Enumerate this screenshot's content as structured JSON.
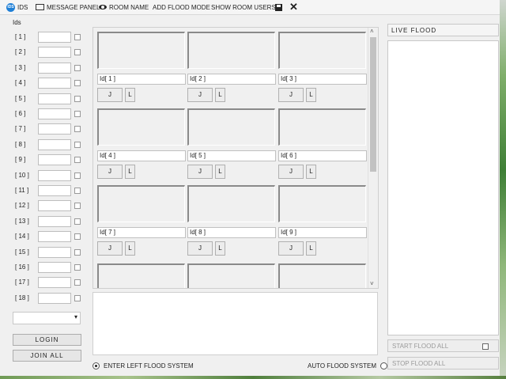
{
  "menu": {
    "ids": "IDS",
    "message_panel": "MESSAGE PANEL",
    "room_name": "ROOM NAME",
    "add_flood_mode": "ADD FLOOD MODE",
    "show_room_users": "SHOW ROOM USERS"
  },
  "left": {
    "title": "Ids",
    "rows": [
      "[ 1 ]",
      "[ 2 ]",
      "[ 3 ]",
      "[ 4 ]",
      "[ 5 ]",
      "[ 6 ]",
      "[ 7 ]",
      "[ 8 ]",
      "[ 9 ]",
      "[ 10 ]",
      "[ 11 ]",
      "[ 12 ]",
      "[ 13 ]",
      "[ 14 ]",
      "[ 15 ]",
      "[ 16 ]",
      "[ 17 ]",
      "[ 18 ]"
    ],
    "login": "LOGIN",
    "join_all": "JOIN ALL"
  },
  "grid": {
    "cells": [
      "Id[ 1 ]",
      "Id[ 2 ]",
      "Id[ 3 ]",
      "Id[ 4 ]",
      "Id[ 5 ]",
      "Id[ 6 ]",
      "Id[ 7 ]",
      "Id[ 8 ]",
      "Id[ 9 ]"
    ],
    "j_label": "J",
    "l_label": "L",
    "scroll_up": "˄",
    "scroll_down": "˅"
  },
  "bottom": {
    "enter_left": "ENTER LEFT FLOOD SYSTEM",
    "auto_flood": "AUTO FLOOD SYSTEM"
  },
  "right": {
    "live_flood": "LIVE FLOOD",
    "start_flood_all": "START FLOOD ALL",
    "stop_flood_all": "STOP FLOOD ALL"
  }
}
